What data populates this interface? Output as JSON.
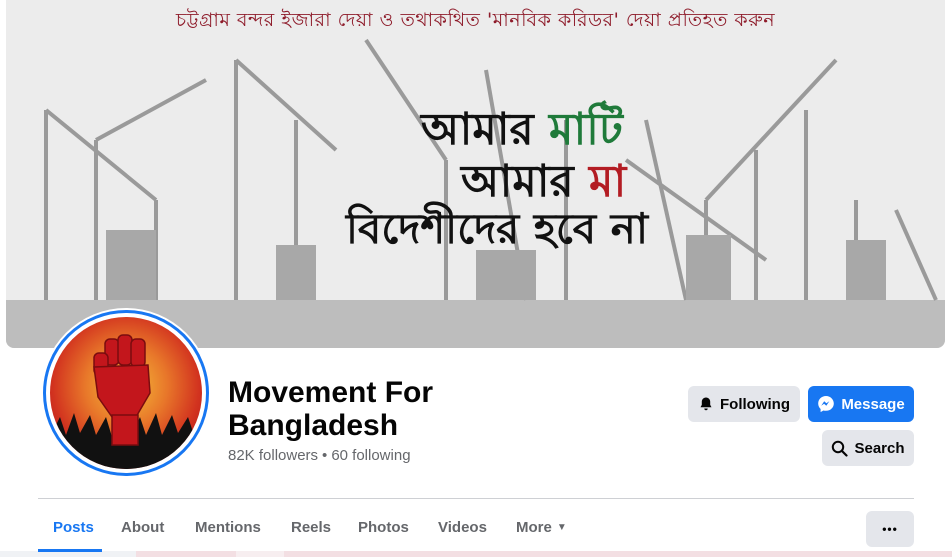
{
  "cover": {
    "top_text": "চট্টগ্রাম বন্দর ইজারা দেয়া ও তথাকথিত 'মানবিক করিডর' দেয়া প্রতিহত করুন",
    "slogan_line1_a": "আমার ",
    "slogan_line1_b": "মাটি",
    "slogan_line2_a": "আমার ",
    "slogan_line2_b": "মা",
    "slogan_line3": "বিদেশীদের হবে না"
  },
  "page": {
    "title": "Movement For Bangladesh",
    "followers": "82K followers",
    "separator": "•",
    "following": "60 following"
  },
  "actions": {
    "following_label": "Following",
    "message_label": "Message",
    "search_label": "Search",
    "more_label": "•••"
  },
  "tabs": [
    {
      "label": "Posts",
      "active": true
    },
    {
      "label": "About"
    },
    {
      "label": "Mentions"
    },
    {
      "label": "Reels"
    },
    {
      "label": "Photos"
    },
    {
      "label": "Videos"
    },
    {
      "label": "More"
    }
  ],
  "icons": {
    "following": "bell-icon",
    "message": "messenger-icon",
    "search": "search-icon",
    "more_tab": "caret-down-icon"
  },
  "colors": {
    "accent": "#1877f2",
    "button_grey": "#e4e6eb",
    "cover_title": "#8e1b2a",
    "slogan_green": "#1f7a3a",
    "slogan_red": "#b31c23"
  }
}
